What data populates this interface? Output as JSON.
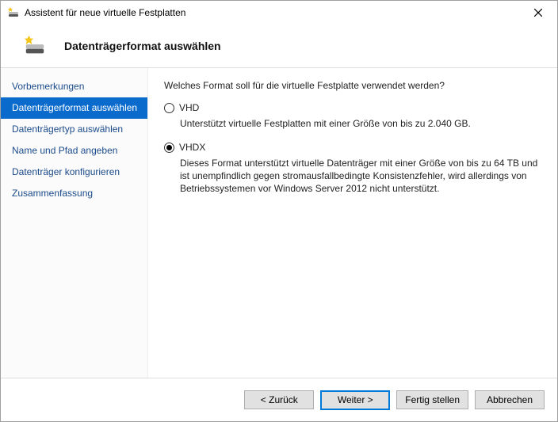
{
  "window": {
    "title": "Assistent für neue virtuelle Festplatten"
  },
  "header": {
    "title": "Datenträgerformat auswählen"
  },
  "sidebar": {
    "items": [
      {
        "label": "Vorbemerkungen",
        "active": false
      },
      {
        "label": "Datenträgerformat auswählen",
        "active": true
      },
      {
        "label": "Datenträgertyp auswählen",
        "active": false
      },
      {
        "label": "Name und Pfad angeben",
        "active": false
      },
      {
        "label": "Datenträger konfigurieren",
        "active": false
      },
      {
        "label": "Zusammenfassung",
        "active": false
      }
    ]
  },
  "content": {
    "question": "Welches Format soll für die virtuelle Festplatte verwendet werden?",
    "options": [
      {
        "value": "VHD",
        "label": "VHD",
        "selected": false,
        "description": "Unterstützt virtuelle Festplatten mit einer Größe von bis zu 2.040 GB."
      },
      {
        "value": "VHDX",
        "label": "VHDX",
        "selected": true,
        "description": "Dieses Format unterstützt virtuelle Datenträger mit einer Größe von bis zu 64 TB und ist unempfindlich gegen stromausfallbedingte Konsistenzfehler, wird allerdings von Betriebssystemen vor Windows Server 2012 nicht unterstützt."
      }
    ]
  },
  "footer": {
    "back": "< Zurück",
    "next": "Weiter >",
    "finish": "Fertig stellen",
    "cancel": "Abbrechen"
  }
}
